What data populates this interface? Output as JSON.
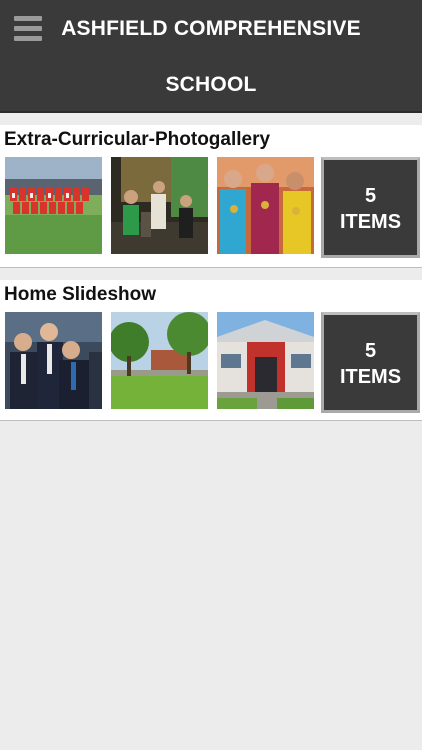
{
  "app": {
    "title_line1": "ASHFIELD COMPREHENSIVE",
    "title_line2": "SCHOOL",
    "menu_icon": "hamburger-menu-icon"
  },
  "galleries": [
    {
      "title": "Extra-Curricular-Photogallery",
      "count": "5",
      "count_label": "ITEMS",
      "thumbnails": [
        "team-photo-football",
        "stage-performance",
        "students-with-medals"
      ]
    },
    {
      "title": "Home Slideshow",
      "count": "5",
      "count_label": "ITEMS",
      "thumbnails": [
        "students-in-uniform",
        "school-grounds-trees",
        "school-building-entrance"
      ]
    }
  ],
  "colors": {
    "header_bg": "#3a3a3a",
    "page_bg": "#ececec",
    "tile_bg": "#3a3a3a",
    "tile_border": "#a9a9a9"
  }
}
